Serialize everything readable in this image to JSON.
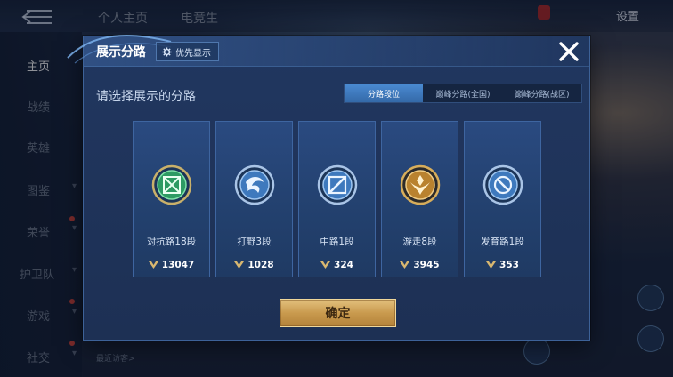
{
  "topbar": {
    "tabs": [
      "个人主页",
      "电竞生"
    ],
    "settings_label": "设置"
  },
  "sidebar": {
    "items": [
      {
        "label": "主页",
        "active": true
      },
      {
        "label": "战绩",
        "active": false
      },
      {
        "label": "英雄",
        "active": false
      },
      {
        "label": "图鉴",
        "active": false
      },
      {
        "label": "荣誉",
        "active": false
      },
      {
        "label": "护卫队",
        "active": false
      },
      {
        "label": "游戏",
        "active": false
      },
      {
        "label": "社交",
        "active": false
      }
    ]
  },
  "background": {
    "bottom_hint": "最近访客>"
  },
  "modal": {
    "title": "展示分路",
    "priority_label": "优先显示",
    "subtitle": "请选择展示的分路",
    "tabs": [
      {
        "label": "分路段位",
        "active": true
      },
      {
        "label": "巅峰分路(全国)",
        "active": false
      },
      {
        "label": "巅峰分路(战区)",
        "active": false
      }
    ],
    "cards": [
      {
        "rank": "对抗路18段",
        "score": "13047",
        "icon": "clash-lane-icon",
        "color": "#3fbf7a"
      },
      {
        "rank": "打野3段",
        "score": "1028",
        "icon": "jungle-icon",
        "color": "#6aa6e0"
      },
      {
        "rank": "中路1段",
        "score": "324",
        "icon": "mid-lane-icon",
        "color": "#8fb8e6"
      },
      {
        "rank": "游走8段",
        "score": "3945",
        "icon": "roam-icon",
        "color": "#d8a653"
      },
      {
        "rank": "发育路1段",
        "score": "353",
        "icon": "farm-lane-icon",
        "color": "#8fb8e6"
      }
    ],
    "confirm_label": "确定"
  },
  "colors": {
    "accent_blue": "#3f7fc8",
    "confirm_gold": "#c99a4e",
    "panel_bg": "#213760"
  }
}
